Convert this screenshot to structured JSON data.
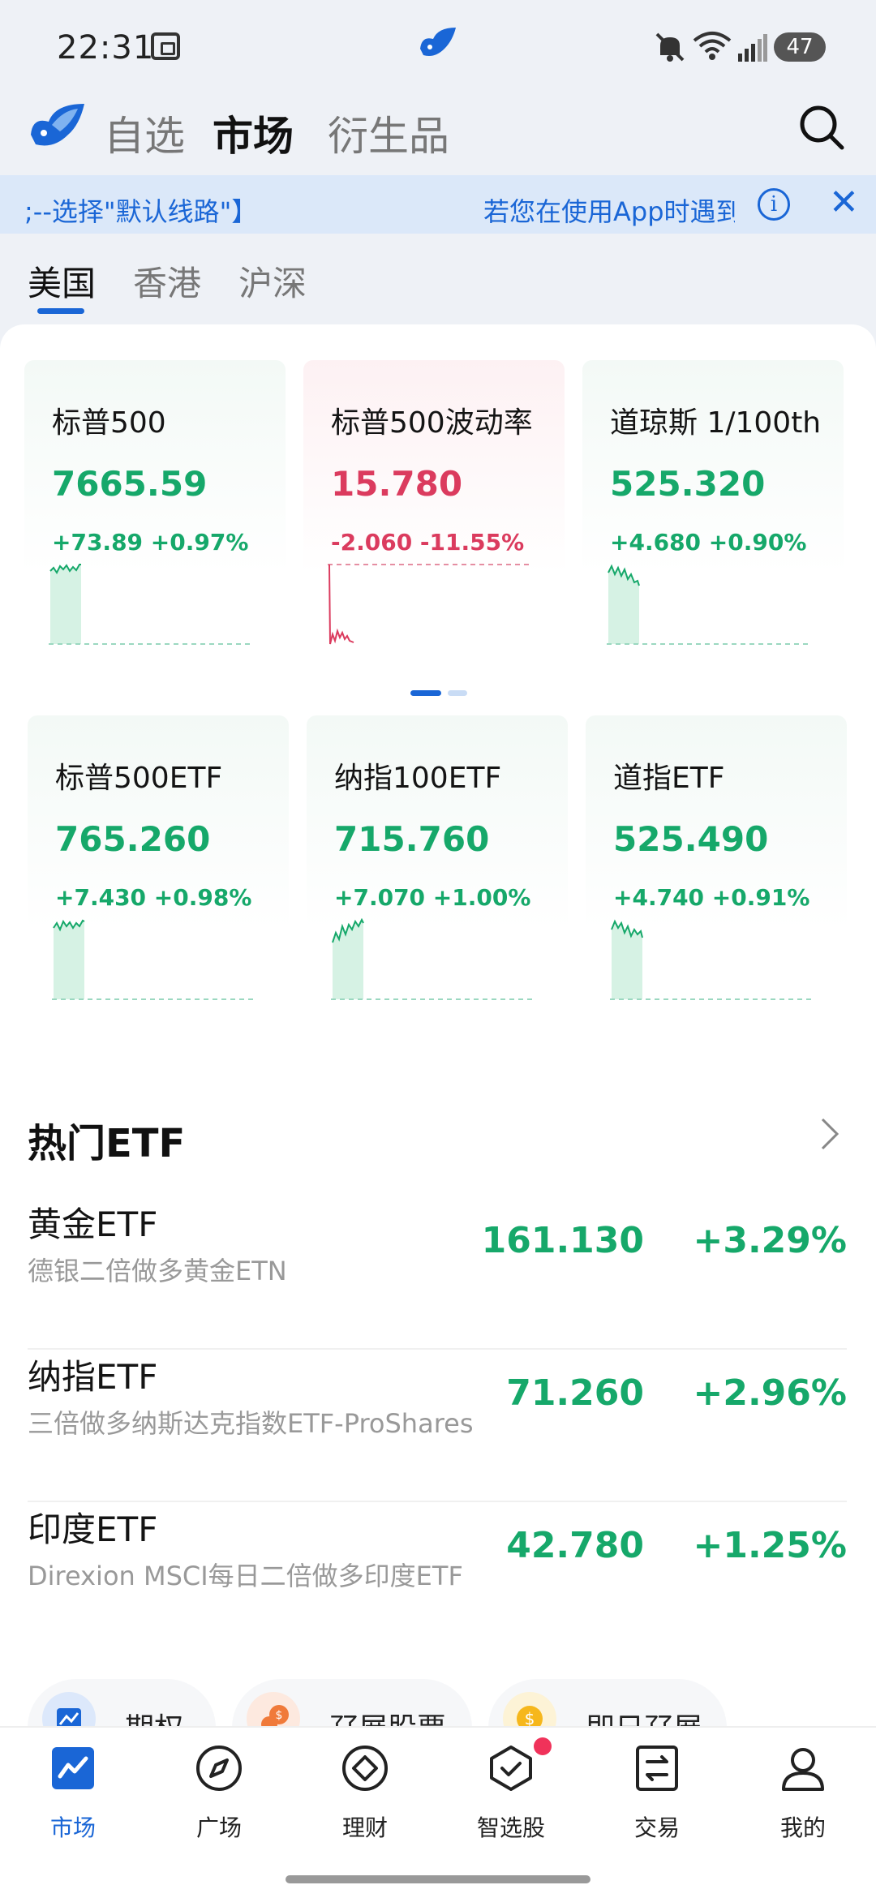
{
  "status_bar": {
    "time": "22:31",
    "battery": "47"
  },
  "top_nav": {
    "tabs": [
      {
        "label": "自选"
      },
      {
        "label": "市场"
      },
      {
        "label": "衍生品"
      }
    ],
    "active_tab": "市场"
  },
  "notice": {
    "text_left": ";--选择\"默认线路\"】",
    "text_right": "若您在使用App时遇到"
  },
  "region_tabs": [
    {
      "label": "美国"
    },
    {
      "label": "香港"
    },
    {
      "label": "沪深"
    }
  ],
  "index_cards": [
    {
      "name": "标普500",
      "value": "7665.59",
      "change": "+73.89 +0.97%",
      "direction": "up"
    },
    {
      "name": "标普500波动率",
      "value": "15.780",
      "change": "-2.060 -11.55%",
      "direction": "down"
    },
    {
      "name": "道琼斯 1/100th",
      "value": "525.320",
      "change": "+4.680 +0.90%",
      "direction": "up"
    },
    {
      "name": "标普500ETF",
      "value": "765.260",
      "change": "+7.430 +0.98%",
      "direction": "up"
    },
    {
      "name": "纳指100ETF",
      "value": "715.760",
      "change": "+7.070 +1.00%",
      "direction": "up"
    },
    {
      "name": "道指ETF",
      "value": "525.490",
      "change": "+4.740 +0.91%",
      "direction": "up"
    }
  ],
  "hot_etf": {
    "title": "热门ETF",
    "items": [
      {
        "name": "黄金ETF",
        "desc": "德银二倍做多黄金ETN",
        "price": "161.130",
        "pct": "+3.29%"
      },
      {
        "name": "纳指ETF",
        "desc": "三倍做多纳斯达克指数ETF-ProShares",
        "price": "71.260",
        "pct": "+2.96%"
      },
      {
        "name": "印度ETF",
        "desc": "Direxion MSCI每日二倍做多印度ETF",
        "price": "42.780",
        "pct": "+1.25%"
      }
    ]
  },
  "shortcuts": [
    {
      "label": "期权"
    },
    {
      "label": "孖展股票"
    },
    {
      "label": "即日孖展"
    }
  ],
  "bottom_tabs": [
    {
      "label": "市场",
      "icon": "chart-icon"
    },
    {
      "label": "广场",
      "icon": "compass-icon"
    },
    {
      "label": "理财",
      "icon": "diamond-icon"
    },
    {
      "label": "智选股",
      "icon": "hexagon-check-icon"
    },
    {
      "label": "交易",
      "icon": "trade-icon"
    },
    {
      "label": "我的",
      "icon": "person-icon"
    }
  ],
  "colors": {
    "accent": "#1a66d6",
    "up": "#16a86a",
    "down": "#db3b5e"
  }
}
